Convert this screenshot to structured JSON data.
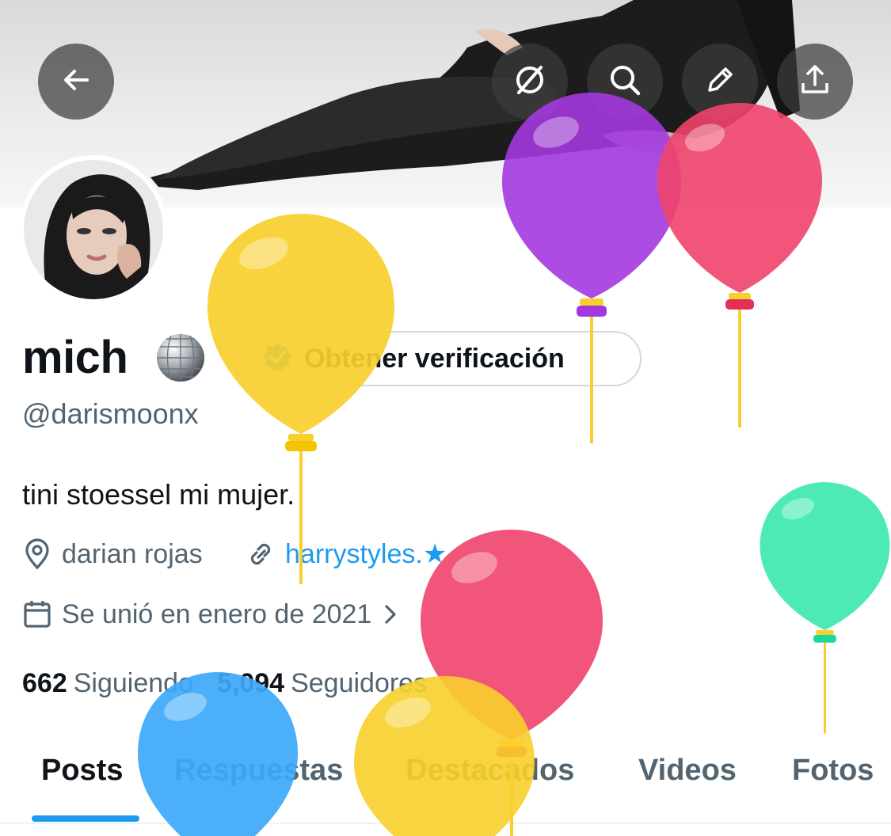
{
  "header": {
    "back_icon": "arrow-left-icon",
    "actions": [
      "grok-icon",
      "search-icon",
      "pencil-icon",
      "share-icon"
    ]
  },
  "profile": {
    "name": "mich",
    "name_emoji": "mirror-ball",
    "verify_label": "Obtener verificación",
    "handle": "@darismoonx",
    "bio": "tini stoessel mi mujer.",
    "location": "darian rojas",
    "website": "harrystyles.★",
    "joined": "Se unió en enero de 2021"
  },
  "stats": {
    "following_count": "662",
    "following_label": "Siguiendo",
    "followers_count": "5,094",
    "followers_label": "Seguidores"
  },
  "tabs": [
    "Posts",
    "Respuestas",
    "Destacados",
    "Videos",
    "Fotos"
  ],
  "active_tab": "Posts",
  "colors": {
    "accent": "#1d9bf0",
    "balloon_yellow": "#f8cf2c",
    "balloon_purple": "#a338e0",
    "balloon_red": "#f0446c",
    "balloon_green": "#3ae8b0",
    "balloon_blue": "#3ca8f8"
  }
}
